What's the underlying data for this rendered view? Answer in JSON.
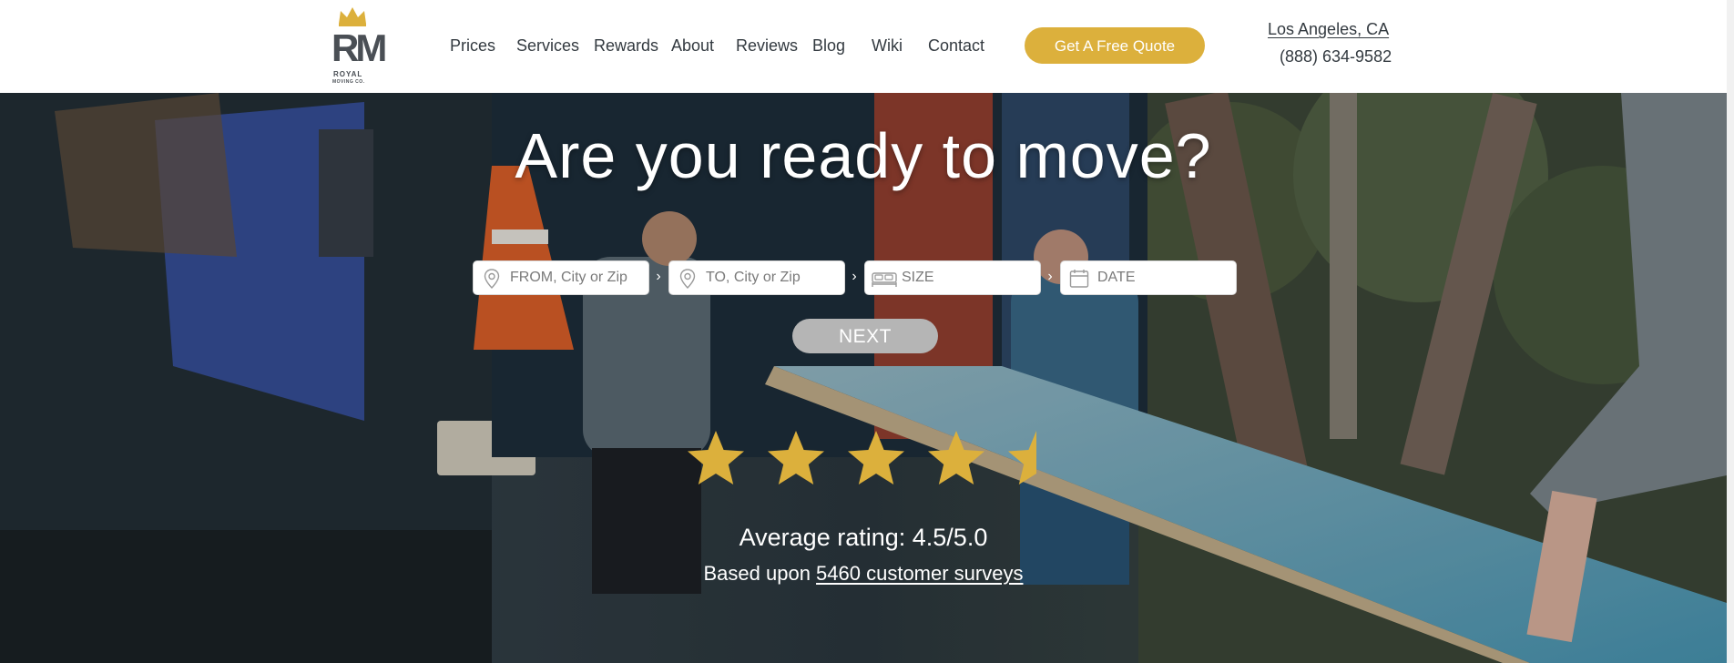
{
  "brand": {
    "logo_monogram": "RM",
    "logo_word": "ROYAL",
    "logo_subword": "MOVING CO.",
    "accent_color": "#dcb03c",
    "crown_icon": "crown-icon"
  },
  "nav": {
    "items": [
      {
        "label": "Prices"
      },
      {
        "label": "Services"
      },
      {
        "label": "Rewards"
      },
      {
        "label": "About"
      },
      {
        "label": "Reviews"
      },
      {
        "label": "Blog"
      },
      {
        "label": "Wiki"
      },
      {
        "label": "Contact"
      }
    ],
    "quote_button": "Get A Free Quote",
    "location": "Los Angeles, CA",
    "phone": "(888) 634-9582"
  },
  "hero": {
    "title": "Are you ready to move?",
    "form": {
      "from_placeholder": "FROM, City or Zip",
      "to_placeholder": "TO, City or Zip",
      "size_placeholder": "SIZE",
      "date_placeholder": "DATE",
      "separator": "›",
      "from_icon": "map-pin-icon",
      "to_icon": "map-pin-icon",
      "size_icon": "bed-icon",
      "date_icon": "calendar-icon"
    },
    "next_button": "NEXT",
    "rating": {
      "stars_filled": 4.5,
      "stars_total": 5,
      "star_color": "#dcb03c",
      "average_text": "Average rating: 4.5/5.0",
      "based_prefix": "Based upon ",
      "surveys_link": "5460 customer surveys"
    }
  }
}
